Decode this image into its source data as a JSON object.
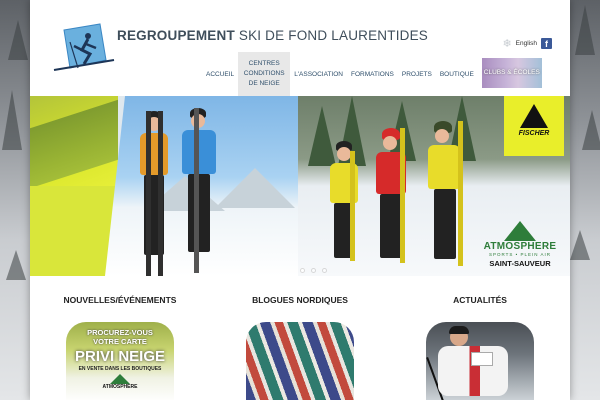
{
  "header": {
    "title_bold": "REGROUPEMENT",
    "title_rest": " SKI DE FOND LAURENTIDES",
    "language_link": "English"
  },
  "nav": {
    "items": [
      {
        "label": "ACCUEIL"
      },
      {
        "label": "CENTRES CONDITIONS DE NEIGE",
        "active": true
      },
      {
        "label": "L'ASSOCIATION"
      },
      {
        "label": "FORMATIONS"
      },
      {
        "label": "PROJETS"
      },
      {
        "label": "BOUTIQUE"
      },
      {
        "label": "CLUBS & ÉCOLES"
      }
    ]
  },
  "banner": {
    "sponsor_1": "FISCHER",
    "sponsor_2_name": "ATMOSPHERE",
    "sponsor_2_sub": "SPORTS • PLEIN AIR",
    "sponsor_2_location": "SAINT-SAUVEUR",
    "slide_count": 3,
    "active_slide": 1
  },
  "sections": [
    {
      "title": "NOUVELLES/ÉVÉNEMENTS",
      "promo_line1": "PROCUREZ-VOUS",
      "promo_line2": "VOTRE CARTE",
      "promo_big": "PRIVI NEIGE",
      "promo_line3": "EN VENTE DANS LES BOUTIQUES",
      "promo_brand": "ATMOSPHERE"
    },
    {
      "title": "BLOGUES NORDIQUES"
    },
    {
      "title": "ACTUALITÉS"
    }
  ],
  "colors": {
    "title": "#3f4e5b",
    "nav_text": "#2f4f6b",
    "fischer_yellow": "#e9ee2a",
    "atmosphere_green": "#2e7d3a",
    "facebook": "#3b5998"
  }
}
